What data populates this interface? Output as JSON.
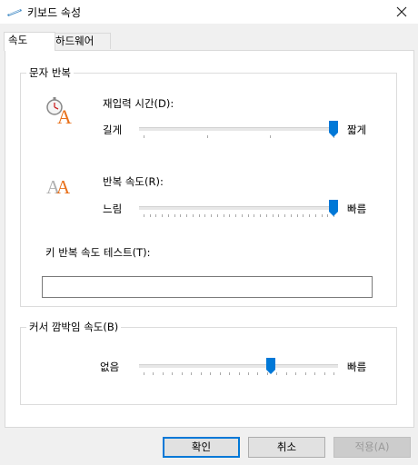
{
  "window": {
    "title": "키보드 속성"
  },
  "tabs": [
    {
      "label": "속도"
    },
    {
      "label": "하드웨어"
    }
  ],
  "char_repeat": {
    "group_label": "문자 반복",
    "repeat_delay": {
      "label": "재입력 시간(D):",
      "min_label": "길게",
      "max_label": "짧게",
      "value_fraction": 1.0,
      "tick_count": 4
    },
    "repeat_rate": {
      "label": "반복 속도(R):",
      "min_label": "느림",
      "max_label": "빠름",
      "value_fraction": 1.0,
      "tick_count": 32
    },
    "test": {
      "label": "키 반복 속도 테스트(T):",
      "value": ""
    }
  },
  "cursor_blink": {
    "group_label": "커서 깜박임 속도(B)",
    "rate": {
      "min_label": "없음",
      "max_label": "빠름",
      "value_fraction": 0.67,
      "tick_count": 21
    }
  },
  "buttons": {
    "ok": "확인",
    "cancel": "취소",
    "apply": "적용(A)"
  },
  "icons": {
    "window": "keyboard-icon",
    "close": "close-icon",
    "repeat_delay": "stopwatch-letter-icon",
    "repeat_rate": "double-letter-icon"
  },
  "colors": {
    "accent": "#0078d7",
    "letter_orange": "#e8711c"
  }
}
